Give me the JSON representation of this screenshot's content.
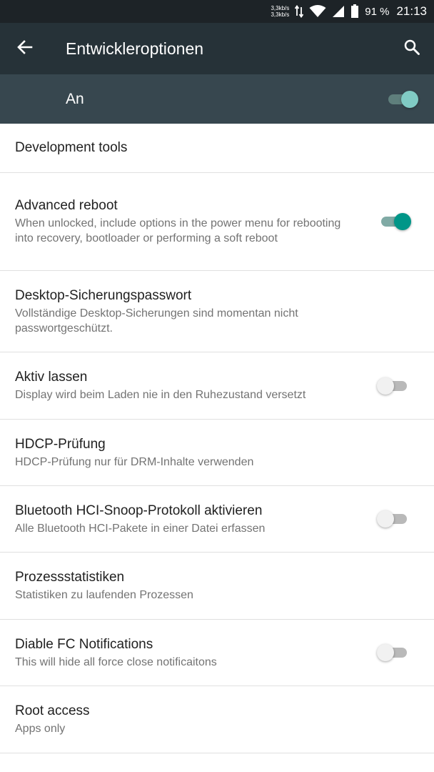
{
  "status_bar": {
    "net_up": "3,3kb/s",
    "net_down": "3,3kb/s",
    "icons": [
      "data-transfer-icon",
      "wifi-icon",
      "cell-signal-icon",
      "battery-icon"
    ],
    "battery": "91 %",
    "time": "21:13"
  },
  "app_bar": {
    "title": "Entwickleroptionen",
    "back_icon": "arrow-back-icon",
    "search_icon": "search-icon"
  },
  "master_switch": {
    "label": "An",
    "state": true
  },
  "colors": {
    "app_bar": "#263238",
    "status_bar": "#1d2327",
    "master_bar": "#37474f",
    "accent": "#009688",
    "master_thumb": "#80cbc4"
  },
  "list": {
    "category": "Development tools",
    "items": [
      {
        "title": "Advanced reboot",
        "summary": "When unlocked, include options in the power menu for rebooting into recovery, bootloader or performing a soft reboot",
        "switch": true
      },
      {
        "title": "Desktop-Sicherungspasswort",
        "summary": "Vollständige Desktop-Sicherungen sind momentan nicht passwortgeschützt."
      },
      {
        "title": "Aktiv lassen",
        "summary": "Display wird beim Laden nie in den Ruhezustand versetzt",
        "switch": false
      },
      {
        "title": "HDCP-Prüfung",
        "summary": "HDCP-Prüfung nur für DRM-Inhalte verwenden"
      },
      {
        "title": "Bluetooth HCI-Snoop-Protokoll aktivieren",
        "summary": "Alle Bluetooth HCI-Pakete in einer Datei erfassen",
        "switch": false
      },
      {
        "title": "Prozessstatistiken",
        "summary": "Statistiken zu laufenden Prozessen"
      },
      {
        "title": "Diable FC Notifications",
        "summary": "This will hide all force close notificaitons",
        "switch": false
      },
      {
        "title": "Root access",
        "summary": "Apps only"
      }
    ]
  }
}
